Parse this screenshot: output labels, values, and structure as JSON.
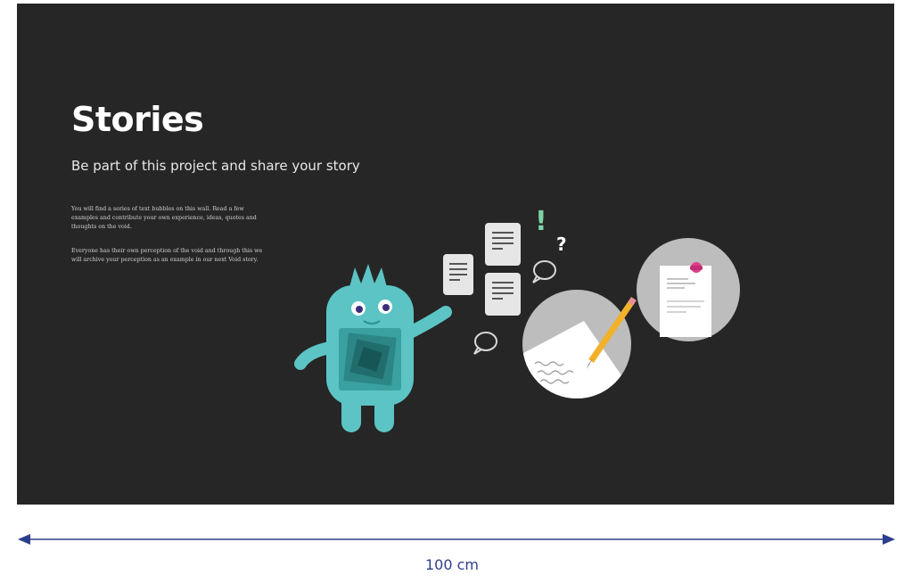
{
  "panel": {
    "title": "Stories",
    "subtitle": "Be part of this project and share your story",
    "paragraphs": [
      "You will find a series of text bubbles on this wall. Read a few examples and contribute your own experience, ideas, quotes and thoughts on the void.",
      "Everyone has their own perception of the void and through this we will archive your perception as an example in our next Void story."
    ],
    "illustration_marks": {
      "exclamation": "!",
      "question": "?"
    }
  },
  "dimension": {
    "label": "100 cm"
  },
  "colors": {
    "panel_bg": "#262626",
    "monster": "#5cc4c4",
    "accent_green": "#7dd3a8",
    "pencil": "#f2b12b",
    "pin": "#e03d8c",
    "dimension": "#2d3e8c"
  }
}
